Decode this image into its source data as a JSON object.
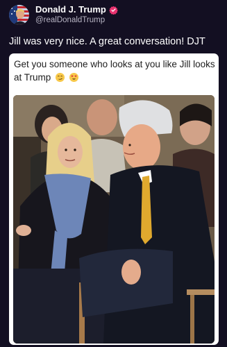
{
  "author": {
    "display_name": "Donald J. Trump",
    "handle": "@realDonaldTrump",
    "avatar": "flag-portrait-avatar",
    "verified_icon": "verified-badge-icon",
    "verified_color": "#e8326f"
  },
  "post": {
    "text": "Jill was very nice. A great conversation! DJT"
  },
  "embedded_card": {
    "text": "Get you someone who looks at you like Jill looks at Trump",
    "emojis": [
      "smirking-face-emoji",
      "heart-eyes-emoji"
    ],
    "photo": "photo-jill-biden-donald-trump-seated"
  },
  "colors": {
    "background": "#130f22",
    "card": "#ffffff"
  }
}
